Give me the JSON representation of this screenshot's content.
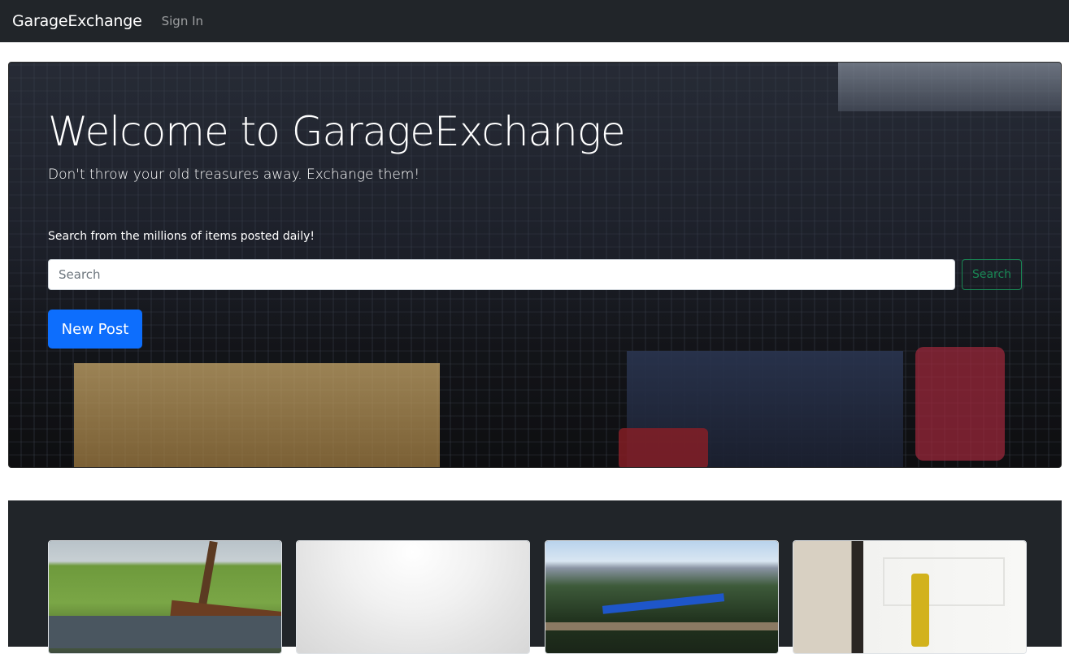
{
  "navbar": {
    "brand": "GarageExchange",
    "sign_in": "Sign In"
  },
  "hero": {
    "title": "Welcome to GarageExchange",
    "subtitle": "Don't throw your old treasures away. Exchange them!",
    "search_label": "Search from the millions of items posted daily!",
    "search_placeholder": "Search",
    "search_button": "Search",
    "new_post_button": "New Post"
  },
  "colors": {
    "navbar_bg": "#212529",
    "primary": "#0d6efd",
    "success": "#198754"
  },
  "listings": {
    "cards": [
      {
        "image": "hot-tub-photo"
      },
      {
        "image": "white-bowl-photo"
      },
      {
        "image": "blue-bicycle-photo"
      },
      {
        "image": "bike-seat-door-photo"
      }
    ]
  }
}
